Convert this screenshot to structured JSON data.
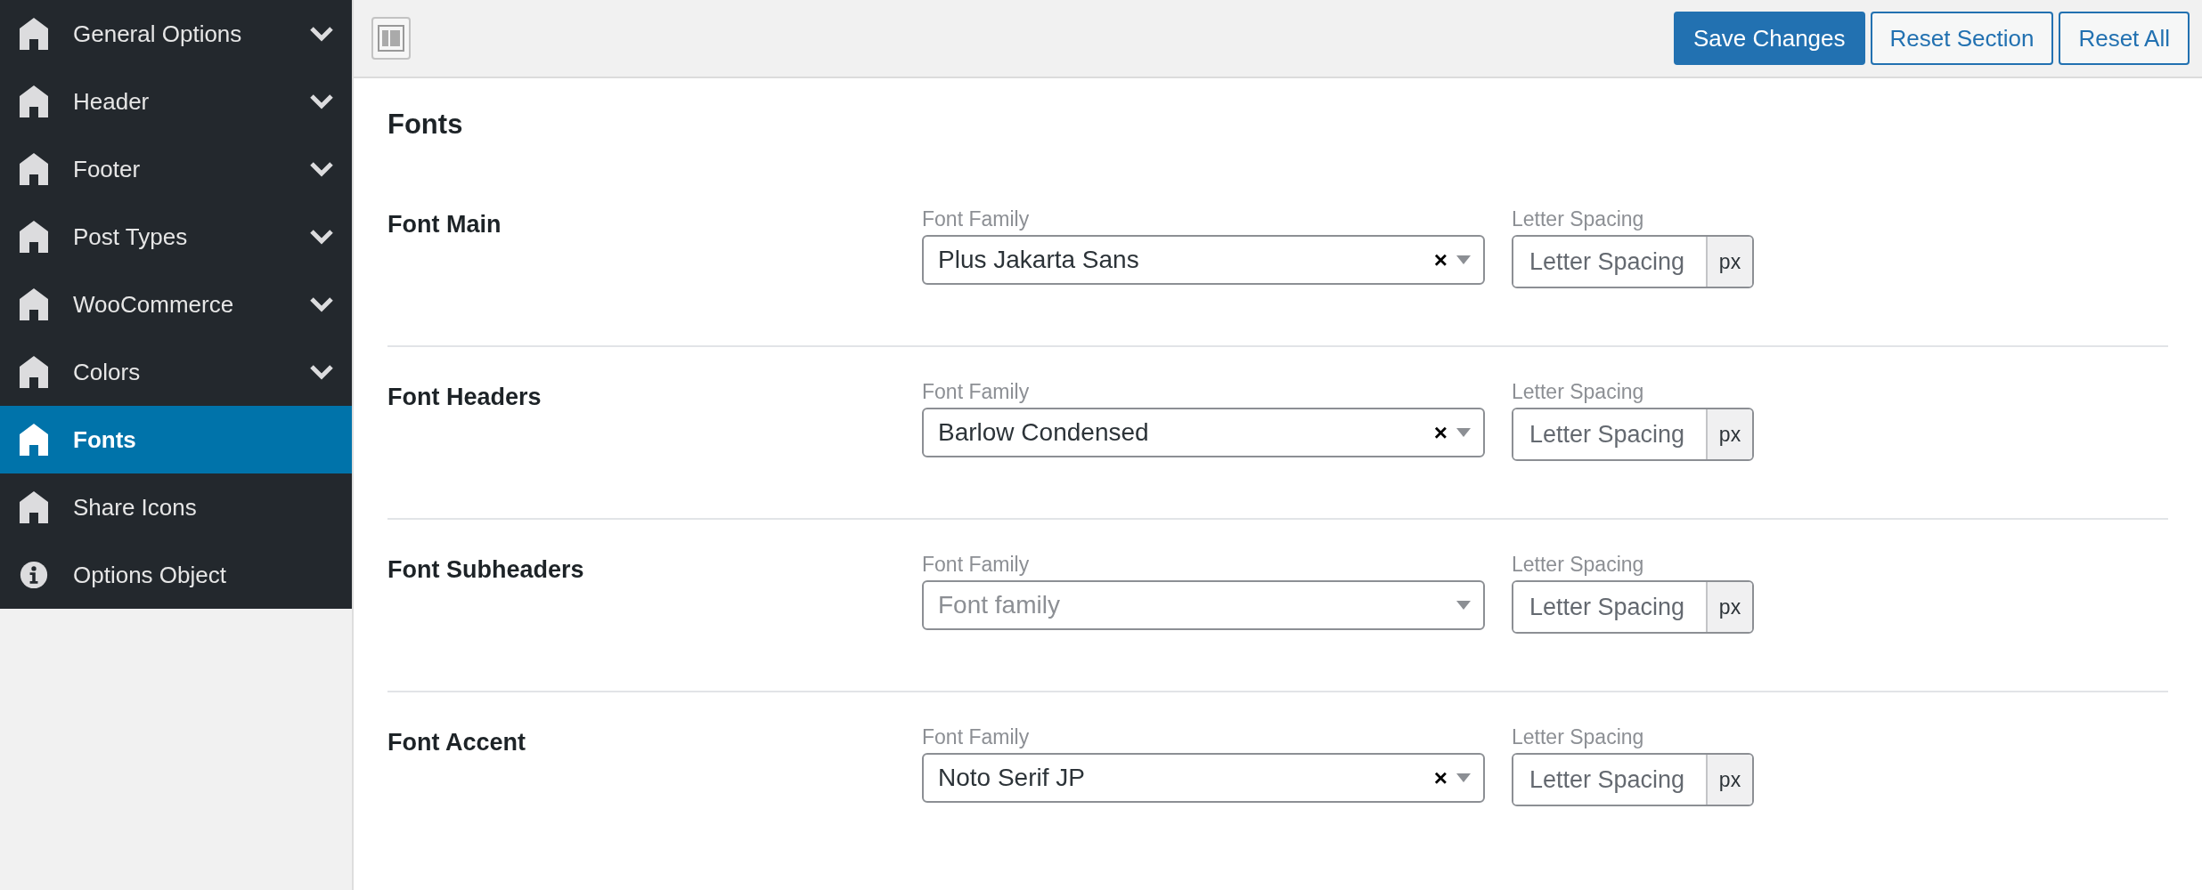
{
  "sidebar": {
    "items": [
      {
        "label": "General Options",
        "kind": "home",
        "expandable": true,
        "selected": false
      },
      {
        "label": "Header",
        "kind": "home",
        "expandable": true,
        "selected": false
      },
      {
        "label": "Footer",
        "kind": "home",
        "expandable": true,
        "selected": false
      },
      {
        "label": "Post Types",
        "kind": "home",
        "expandable": true,
        "selected": false
      },
      {
        "label": "WooCommerce",
        "kind": "home",
        "expandable": true,
        "selected": false
      },
      {
        "label": "Colors",
        "kind": "home",
        "expandable": true,
        "selected": false
      },
      {
        "label": "Fonts",
        "kind": "home",
        "expandable": false,
        "selected": true
      },
      {
        "label": "Share Icons",
        "kind": "home",
        "expandable": false,
        "selected": false
      },
      {
        "label": "Options Object",
        "kind": "info",
        "expandable": false,
        "selected": false
      }
    ]
  },
  "toolbar": {
    "buttons": [
      {
        "label": "Save Changes",
        "kind": "primary"
      },
      {
        "label": "Reset Section",
        "kind": "secondary"
      },
      {
        "label": "Reset All",
        "kind": "secondary"
      }
    ]
  },
  "section": {
    "title": "Fonts",
    "rows": [
      {
        "label": "Font Main",
        "family_label": "Font Family",
        "family_value": "Plus Jakarta Sans",
        "clear": "×",
        "spacing_label": "Letter Spacing",
        "spacing_placeholder": "Letter Spacing",
        "unit": "px"
      },
      {
        "label": "Font Headers",
        "family_label": "Font Family",
        "family_value": "Barlow Condensed",
        "clear": "×",
        "spacing_label": "Letter Spacing",
        "spacing_placeholder": "Letter Spacing",
        "unit": "px"
      },
      {
        "label": "Font Subheaders",
        "family_label": "Font Family",
        "family_placeholder": "Font family",
        "spacing_label": "Letter Spacing",
        "spacing_placeholder": "Letter Spacing",
        "unit": "px"
      },
      {
        "label": "Font Accent",
        "family_label": "Font Family",
        "family_value": "Noto Serif JP",
        "clear": "×",
        "spacing_label": "Letter Spacing",
        "spacing_placeholder": "Letter Spacing",
        "unit": "px"
      }
    ]
  }
}
